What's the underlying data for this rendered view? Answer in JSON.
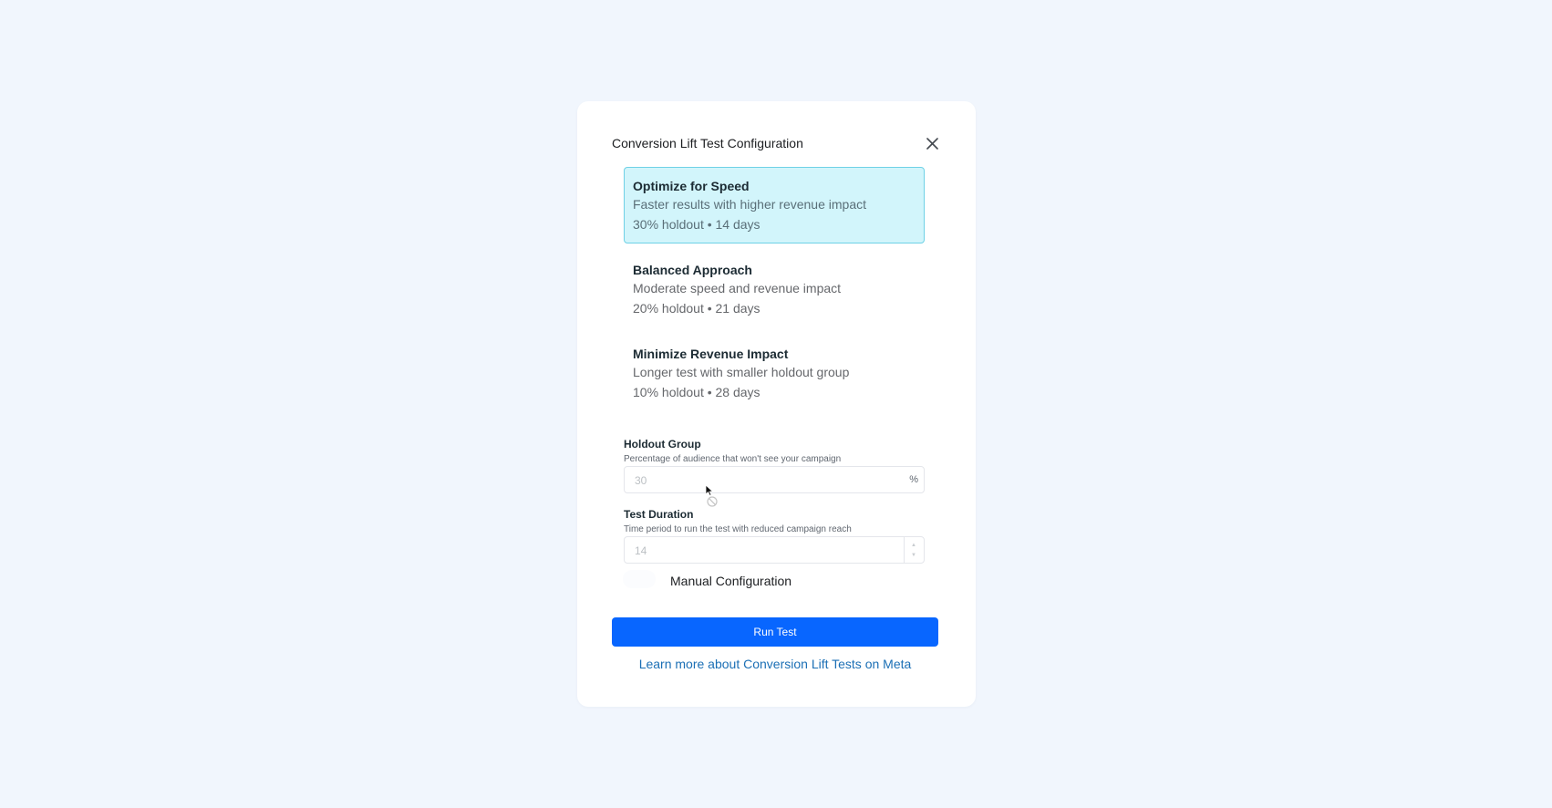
{
  "dialog": {
    "title": "Conversion Lift Test Configuration",
    "close_icon": "close-icon"
  },
  "options": [
    {
      "title": "Optimize for Speed",
      "description": "Faster results with higher revenue impact",
      "meta": "30% holdout • 14 days",
      "selected": true
    },
    {
      "title": "Balanced Approach",
      "description": "Moderate speed and revenue impact",
      "meta": "20% holdout • 21 days",
      "selected": false
    },
    {
      "title": "Minimize Revenue Impact",
      "description": "Longer test with smaller holdout group",
      "meta": "10% holdout • 28 days",
      "selected": false
    }
  ],
  "holdout": {
    "label": "Holdout Group",
    "help": "Percentage of audience that won't see your campaign",
    "value": "30",
    "suffix": "%"
  },
  "duration": {
    "label": "Test Duration",
    "help": "Time period to run the test with reduced campaign reach",
    "value": "14"
  },
  "manual_toggle": {
    "label": "Manual Configuration",
    "enabled": false
  },
  "run_button": "Run Test",
  "learn_link": "Learn more about Conversion Lift Tests on Meta",
  "colors": {
    "background": "#f1f6fd",
    "selected_bg": "#d2f5fb",
    "selected_border": "#6fd1e6",
    "primary_button": "#0866ff",
    "link": "#1b6fb5"
  }
}
